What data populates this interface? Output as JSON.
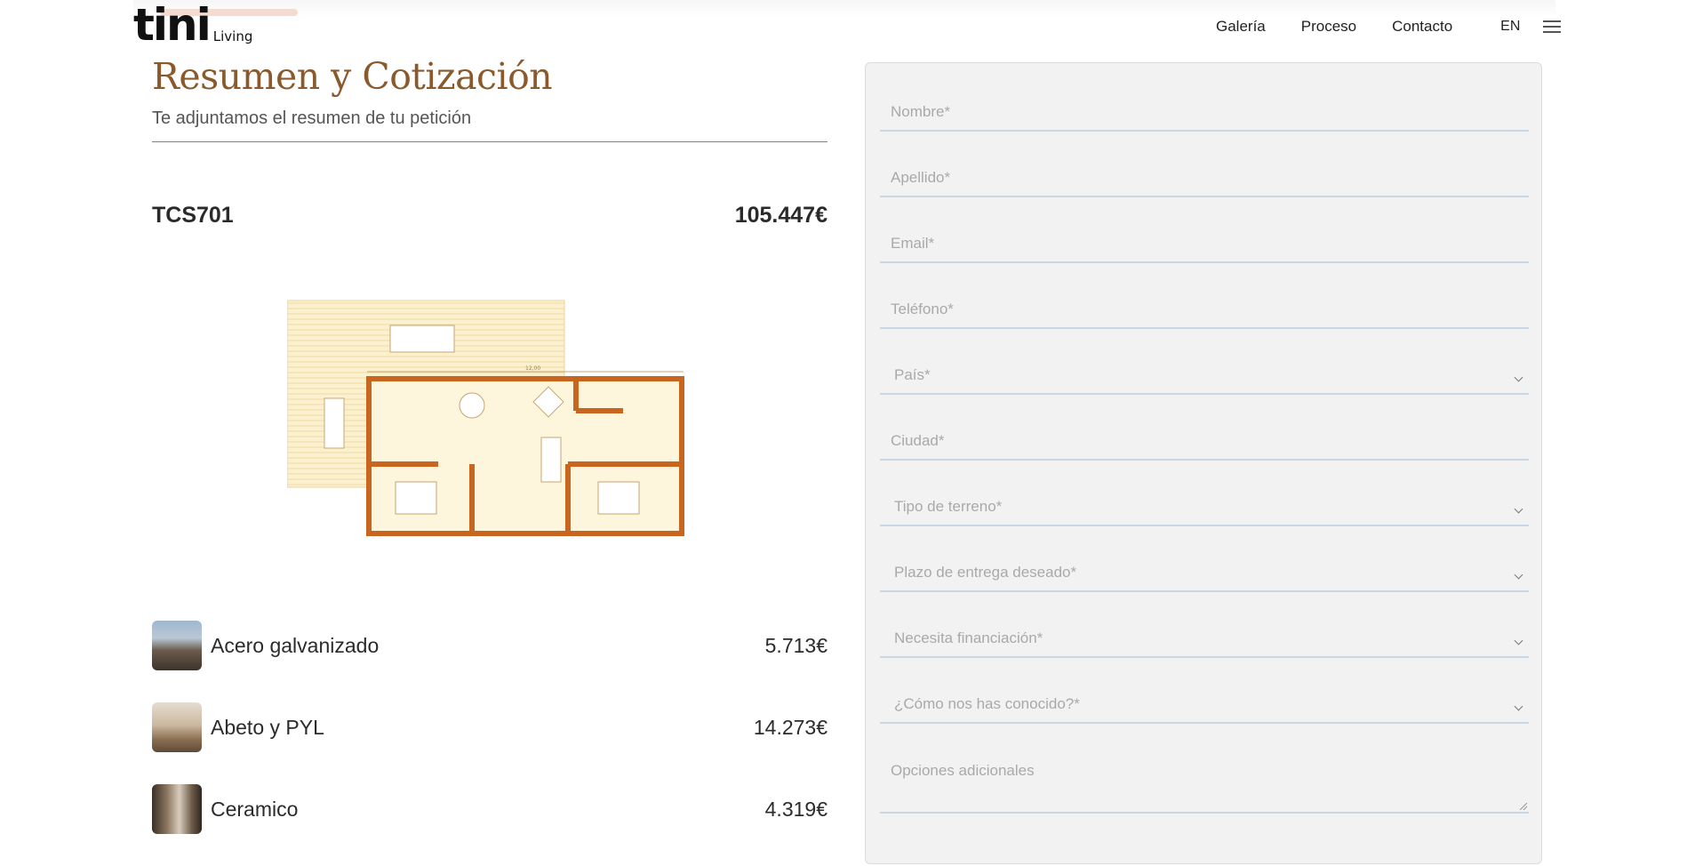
{
  "header": {
    "logo_main": "tini",
    "logo_sub": "Living",
    "nav": {
      "galeria": "Galería",
      "proceso": "Proceso",
      "contacto": "Contacto",
      "lang": "EN"
    },
    "menu_icon": "hamburger-icon"
  },
  "summary": {
    "title": "Resumen y Cotización",
    "subtitle": "Te adjuntamos el resumen de tu petición",
    "model": "TCS701",
    "total_price": "105.447€",
    "floorplan_dimension": "12,00",
    "items": [
      {
        "name": "Acero galvanizado",
        "price": "5.713€"
      },
      {
        "name": "Abeto y PYL",
        "price": "14.273€"
      },
      {
        "name": "Ceramico",
        "price": "4.319€"
      }
    ]
  },
  "form": {
    "nombre": "Nombre*",
    "apellido": "Apellido*",
    "email": "Email*",
    "telefono": "Teléfono*",
    "pais": "País*",
    "ciudad": "Ciudad*",
    "tipo_terreno": "Tipo de terreno*",
    "plazo_entrega": "Plazo de entrega deseado*",
    "financiacion": "Necesita financiación*",
    "como_conocido": "¿Cómo nos has conocido?*",
    "opciones": "Opciones adicionales"
  },
  "colors": {
    "brand_brown": "#8a5a2c",
    "accent_orange": "#c56a3a",
    "wall_orange": "#c8651f",
    "form_bg": "#f2f2f2",
    "field_border": "#c9d6e3"
  }
}
